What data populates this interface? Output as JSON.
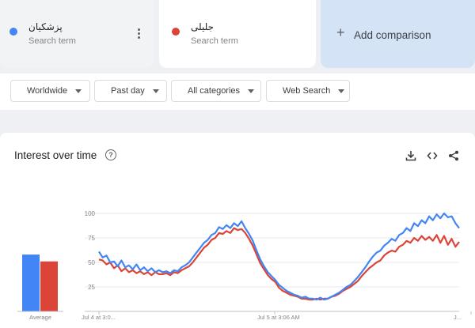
{
  "compare": {
    "terms": [
      {
        "name": "پزشکیان",
        "sub": "Search term",
        "color": "#4285f4"
      },
      {
        "name": "جلیلی",
        "sub": "Search term",
        "color": "#db4437"
      }
    ],
    "add_label": "Add comparison"
  },
  "filters": {
    "region": "Worldwide",
    "time": "Past day",
    "category": "All categories",
    "search_type": "Web Search"
  },
  "panel": {
    "title": "Interest over time",
    "help_glyph": "?"
  },
  "average_label": "Average",
  "chart_data": {
    "type": "line",
    "title": "Interest over time",
    "ylim": [
      0,
      100
    ],
    "y_ticks": [
      "25",
      "50",
      "75",
      "100"
    ],
    "x_tick_labels": [
      "Jul 4 at 3:0...",
      "Jul 5 at 3:06 AM",
      "J..."
    ],
    "grid": true,
    "averages": [
      {
        "name": "پزشکیان",
        "value": 58
      },
      {
        "name": "جلیلی",
        "value": 51
      }
    ],
    "series": [
      {
        "name": "پزشکیان",
        "color": "#4285f4",
        "values": [
          61,
          55,
          57,
          50,
          51,
          46,
          52,
          45,
          47,
          43,
          48,
          42,
          45,
          41,
          44,
          40,
          42,
          40,
          41,
          39,
          42,
          41,
          45,
          47,
          50,
          55,
          60,
          65,
          70,
          73,
          78,
          80,
          86,
          84,
          88,
          85,
          90,
          87,
          92,
          85,
          79,
          72,
          62,
          53,
          46,
          40,
          36,
          32,
          27,
          24,
          21,
          19,
          17,
          16,
          14,
          15,
          13,
          13,
          12,
          14,
          12,
          13,
          15,
          17,
          19,
          22,
          25,
          27,
          31,
          35,
          40,
          45,
          51,
          56,
          60,
          62,
          67,
          70,
          74,
          72,
          78,
          80,
          85,
          82,
          90,
          87,
          93,
          90,
          97,
          93,
          99,
          95,
          100,
          96,
          97,
          90,
          85
        ]
      },
      {
        "name": "جلیلی",
        "color": "#db4437",
        "values": [
          53,
          52,
          48,
          50,
          44,
          47,
          41,
          44,
          40,
          42,
          39,
          41,
          38,
          40,
          37,
          40,
          38,
          38,
          39,
          37,
          40,
          39,
          42,
          44,
          46,
          50,
          55,
          60,
          65,
          68,
          73,
          75,
          80,
          79,
          82,
          80,
          85,
          83,
          84,
          80,
          74,
          67,
          58,
          49,
          43,
          37,
          33,
          30,
          24,
          21,
          19,
          17,
          16,
          15,
          13,
          13,
          12,
          12,
          13,
          12,
          13,
          13,
          15,
          16,
          18,
          21,
          23,
          25,
          28,
          31,
          36,
          40,
          44,
          47,
          50,
          52,
          57,
          60,
          62,
          61,
          66,
          68,
          72,
          70,
          75,
          72,
          77,
          73,
          76,
          72,
          78,
          70,
          77,
          68,
          74,
          66,
          71
        ]
      }
    ]
  }
}
